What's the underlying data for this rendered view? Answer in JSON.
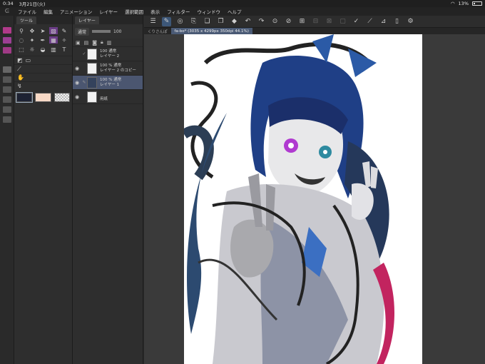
{
  "status": {
    "time": "0:34",
    "date": "3月21日(火)",
    "battery": "13%"
  },
  "menu": [
    "ファイル",
    "編集",
    "アニメーション",
    "レイヤー",
    "選択範囲",
    "表示",
    "フィルター",
    "ウィンドウ",
    "ヘルプ"
  ],
  "tool_panel": {
    "tab_label": "ツール"
  },
  "layer_panel": {
    "tab_label": "レイヤー",
    "blend_mode": "通常",
    "opacity": "100",
    "layers": [
      {
        "opacity_mode": "100 通常",
        "name": "レイヤー 2",
        "visible": false
      },
      {
        "opacity_mode": "100 % 通常",
        "name": "レイヤー 2 のコピー",
        "visible": true
      },
      {
        "opacity_mode": "100 % 通常",
        "name": "レイヤー 1",
        "visible": true,
        "active": true
      },
      {
        "opacity_mode": "",
        "name": "用紙",
        "visible": true
      }
    ]
  },
  "document_tabs": [
    {
      "label": "くりさんぽ",
      "active": false
    },
    {
      "label": "fa-bo* (3035 x 4299px 350dpi 44.1%)",
      "active": true
    }
  ],
  "colors": {
    "main_color": "#1d2233",
    "sub_color": "#f8d9c6",
    "accent": "#3d5778"
  }
}
